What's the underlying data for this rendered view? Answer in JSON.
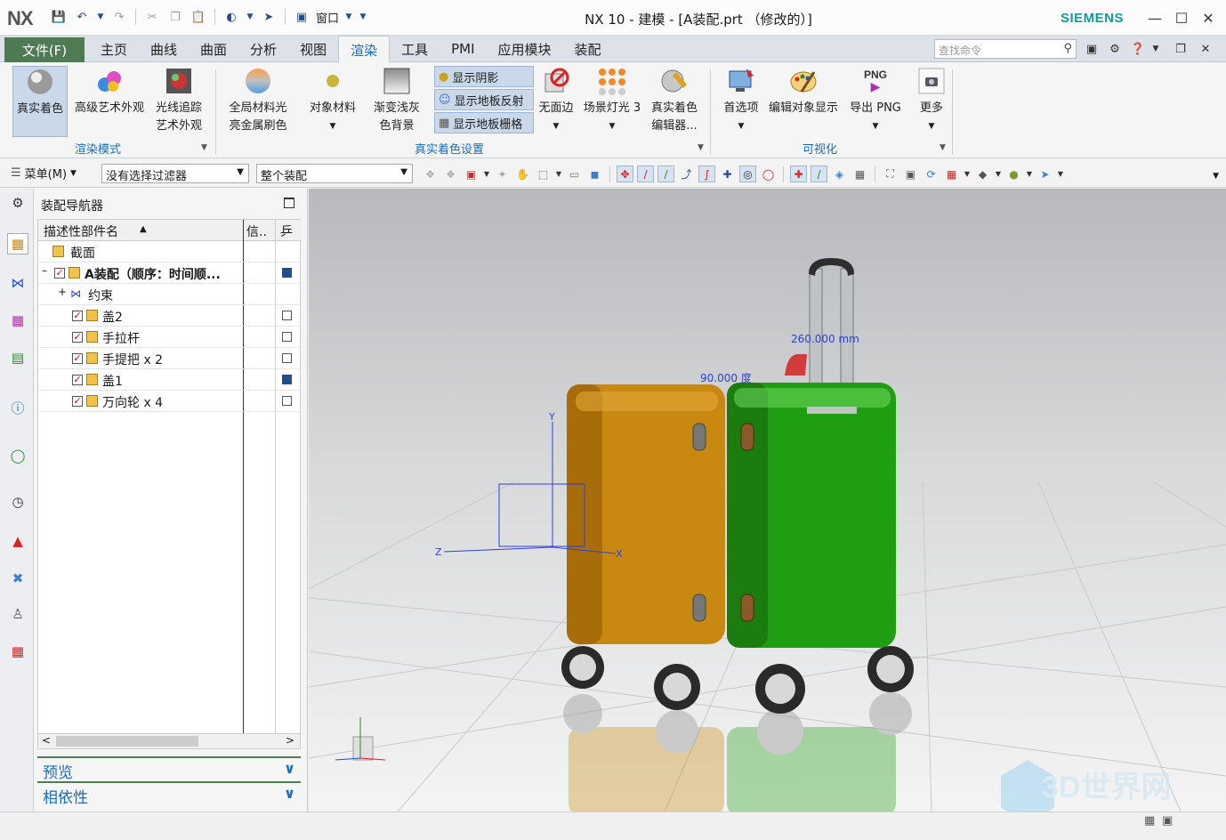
{
  "app": {
    "logo": "NX",
    "title": "NX 10 - 建模 - [A装配.prt （修改的）]",
    "brand": "SIEMENS",
    "window_menu": "窗口"
  },
  "ribbon_tabs": {
    "file": "文件(F)",
    "tabs": [
      "主页",
      "曲线",
      "曲面",
      "分析",
      "视图",
      "渲染",
      "工具",
      "PMI",
      "应用模块",
      "装配"
    ],
    "active": "渲染",
    "search_placeholder": "查找命令"
  },
  "ribbon": {
    "buttons": [
      {
        "label": "真实着色",
        "sub": ""
      },
      {
        "label": "高级艺术外观",
        "sub": ""
      },
      {
        "label": "光线追踪",
        "sub": "艺术外观"
      },
      {
        "label": "全局材料光",
        "sub": "亮金属刷色"
      },
      {
        "label": "对象材料",
        "sub": ""
      },
      {
        "label": "渐变浅灰",
        "sub": "色背景"
      },
      {
        "label": "无面边",
        "sub": ""
      },
      {
        "label": "场景灯光 3",
        "sub": ""
      },
      {
        "label": "真实着色",
        "sub": "编辑器..."
      },
      {
        "label": "首选项",
        "sub": ""
      },
      {
        "label": "编辑对象显示",
        "sub": ""
      },
      {
        "label": "导出 PNG",
        "sub": ""
      },
      {
        "label": "更多",
        "sub": ""
      }
    ],
    "small_buttons": [
      "显示阴影",
      "显示地板反射",
      "显示地板栅格"
    ],
    "png_text": "PNG",
    "groups": [
      "渲染模式",
      "真实着色设置",
      "可视化"
    ]
  },
  "toolbar": {
    "menu": "菜单(M)",
    "filter": "没有选择过滤器",
    "scope": "整个装配"
  },
  "navigator": {
    "title": "装配导航器",
    "columns": {
      "name": "描述性部件名",
      "info": "信..",
      "x": "乒"
    },
    "rows": [
      {
        "label": "截面",
        "indent": 0
      },
      {
        "label": "A装配（顺序：时间顺...",
        "indent": 1
      },
      {
        "label": "约束",
        "indent": 2
      },
      {
        "label": "盖2",
        "indent": 2
      },
      {
        "label": "手拉杆",
        "indent": 2
      },
      {
        "label": "手提把 x 2",
        "indent": 2
      },
      {
        "label": "盖1",
        "indent": 2
      },
      {
        "label": "万向轮 x 4",
        "indent": 2
      }
    ],
    "sections": [
      "预览",
      "相依性"
    ]
  },
  "viewport": {
    "dim_length": "260.000 mm",
    "dim_angle": "90.000 度",
    "axis_x": "X",
    "axis_y": "Y",
    "axis_z": "Z",
    "watermark": "3D世界网",
    "colors": {
      "case_left": "#c9880f",
      "case_right": "#1f9e12",
      "dimension": "#2a43d8"
    }
  }
}
